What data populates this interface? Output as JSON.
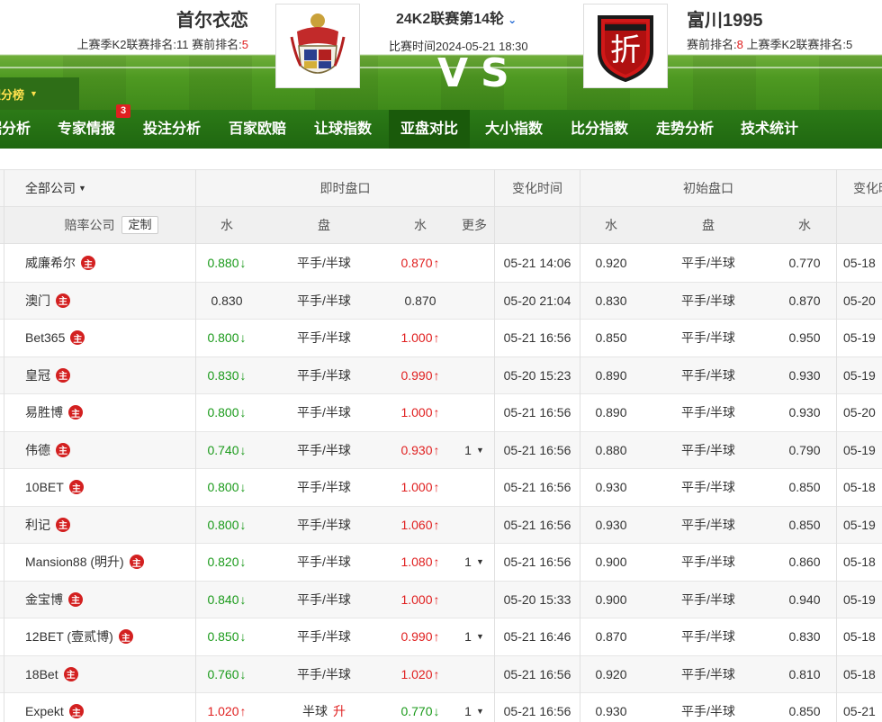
{
  "match": {
    "home_team": "首尔衣恋",
    "home_info_prefix": "上赛季K2联赛排名:11  赛前排名:",
    "home_rank": "5",
    "away_team": "富川1995",
    "away_info_rank_label": "赛前排名:",
    "away_rank": "8",
    "away_info_suffix": "  上赛季K2联赛排名:5",
    "round": "24K2联赛第14轮",
    "time": "比赛时间2024-05-21 18:30",
    "vs": "VS"
  },
  "standings_tab": "积分榜",
  "nav": [
    {
      "label": "数据分析",
      "active": false
    },
    {
      "label": "专家情报",
      "active": false,
      "badge": "3"
    },
    {
      "label": "投注分析",
      "active": false
    },
    {
      "label": "百家欧赔",
      "active": false
    },
    {
      "label": "让球指数",
      "active": false
    },
    {
      "label": "亚盘对比",
      "active": true
    },
    {
      "label": "大小指数",
      "active": false
    },
    {
      "label": "比分指数",
      "active": false
    },
    {
      "label": "走势分析",
      "active": false
    },
    {
      "label": "技术统计",
      "active": false
    }
  ],
  "table": {
    "header1": {
      "company_filter": "全部公司",
      "live": "即时盘口",
      "change_time": "变化时间",
      "initial": "初始盘口",
      "change_time2": "变化时间"
    },
    "header2": {
      "company": "赔率公司",
      "customize": "定制",
      "water1": "水",
      "handicap": "盘",
      "water2": "水",
      "more": "更多",
      "iwater1": "水",
      "ihandicap": "盘",
      "iwater2": "水"
    },
    "main_badge": "主",
    "rows": [
      {
        "company": "威廉希尔",
        "w1": "0.880",
        "w1d": "down",
        "pan": "平手/半球",
        "w2": "0.870",
        "w2d": "up",
        "more": "",
        "time": "05-21 14:06",
        "iw1": "0.920",
        "ipan": "平手/半球",
        "iw2": "0.770",
        "ct": "05-18"
      },
      {
        "company": "澳门",
        "w1": "0.830",
        "w1d": "",
        "pan": "平手/半球",
        "w2": "0.870",
        "w2d": "",
        "more": "",
        "time": "05-20 21:04",
        "iw1": "0.830",
        "ipan": "平手/半球",
        "iw2": "0.870",
        "ct": "05-20"
      },
      {
        "company": "Bet365",
        "w1": "0.800",
        "w1d": "down",
        "pan": "平手/半球",
        "w2": "1.000",
        "w2d": "up",
        "more": "",
        "time": "05-21 16:56",
        "iw1": "0.850",
        "ipan": "平手/半球",
        "iw2": "0.950",
        "ct": "05-19"
      },
      {
        "company": "皇冠",
        "w1": "0.830",
        "w1d": "down",
        "pan": "平手/半球",
        "w2": "0.990",
        "w2d": "up",
        "more": "",
        "time": "05-20 15:23",
        "iw1": "0.890",
        "ipan": "平手/半球",
        "iw2": "0.930",
        "ct": "05-19"
      },
      {
        "company": "易胜博",
        "w1": "0.800",
        "w1d": "down",
        "pan": "平手/半球",
        "w2": "1.000",
        "w2d": "up",
        "more": "",
        "time": "05-21 16:56",
        "iw1": "0.890",
        "ipan": "平手/半球",
        "iw2": "0.930",
        "ct": "05-20"
      },
      {
        "company": "伟德",
        "w1": "0.740",
        "w1d": "down",
        "pan": "平手/半球",
        "w2": "0.930",
        "w2d": "up",
        "more": "1",
        "time": "05-21 16:56",
        "iw1": "0.880",
        "ipan": "平手/半球",
        "iw2": "0.790",
        "ct": "05-19"
      },
      {
        "company": "10BET",
        "w1": "0.800",
        "w1d": "down",
        "pan": "平手/半球",
        "w2": "1.000",
        "w2d": "up",
        "more": "",
        "time": "05-21 16:56",
        "iw1": "0.930",
        "ipan": "平手/半球",
        "iw2": "0.850",
        "ct": "05-18"
      },
      {
        "company": "利记",
        "w1": "0.800",
        "w1d": "down",
        "pan": "平手/半球",
        "w2": "1.060",
        "w2d": "up",
        "more": "",
        "time": "05-21 16:56",
        "iw1": "0.930",
        "ipan": "平手/半球",
        "iw2": "0.850",
        "ct": "05-19"
      },
      {
        "company": "Mansion88 (明升)",
        "w1": "0.820",
        "w1d": "down",
        "pan": "平手/半球",
        "w2": "1.080",
        "w2d": "up",
        "more": "1",
        "time": "05-21 16:56",
        "iw1": "0.900",
        "ipan": "平手/半球",
        "iw2": "0.860",
        "ct": "05-18"
      },
      {
        "company": "金宝博",
        "w1": "0.840",
        "w1d": "down",
        "pan": "平手/半球",
        "w2": "1.000",
        "w2d": "up",
        "more": "",
        "time": "05-20 15:33",
        "iw1": "0.900",
        "ipan": "平手/半球",
        "iw2": "0.940",
        "ct": "05-19"
      },
      {
        "company": "12BET (壹贰博)",
        "w1": "0.850",
        "w1d": "down",
        "pan": "平手/半球",
        "w2": "0.990",
        "w2d": "up",
        "more": "1",
        "time": "05-21 16:46",
        "iw1": "0.870",
        "ipan": "平手/半球",
        "iw2": "0.830",
        "ct": "05-18"
      },
      {
        "company": "18Bet",
        "w1": "0.760",
        "w1d": "down",
        "pan": "平手/半球",
        "w2": "1.020",
        "w2d": "up",
        "more": "",
        "time": "05-21 16:56",
        "iw1": "0.920",
        "ipan": "平手/半球",
        "iw2": "0.810",
        "ct": "05-18"
      },
      {
        "company": "Expekt",
        "w1": "1.020",
        "w1d": "up",
        "pan": "半球",
        "pan_flag": "升",
        "w2": "0.770",
        "w2d": "down",
        "more": "1",
        "time": "05-21 16:56",
        "iw1": "0.930",
        "ipan": "平手/半球",
        "iw2": "0.850",
        "ct": "05-21"
      }
    ]
  },
  "colors": {
    "nav_green": "#2c7a17",
    "nav_active": "#1a5a0b",
    "up_red": "#e02020",
    "down_green": "#1a9a1a",
    "badge_red": "#d32020",
    "standings_yellow": "#ffe14d"
  },
  "icons": {
    "home_logo": "crest-shield-icon",
    "away_logo": "red-shield-crest-icon",
    "up": "arrow-up-icon",
    "down": "arrow-down-icon"
  }
}
